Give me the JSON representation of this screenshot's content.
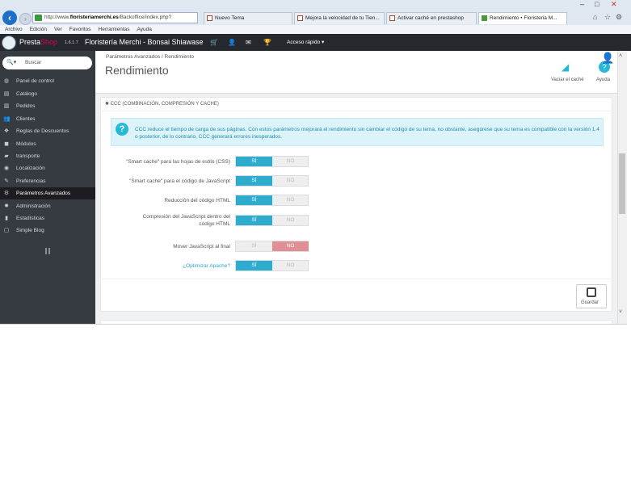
{
  "browser": {
    "url_prefix": "http://www.",
    "url_domain": "floristeriamerchi.es",
    "url_path": "/Backoffice/index.php?",
    "tabs": [
      "Nuevo Tema",
      "Mejora la velocidad de tu Tien...",
      "Activar caché en prestashop",
      "Rendimiento • Floristeria M..."
    ],
    "menu": [
      "Archivo",
      "Edición",
      "Ver",
      "Favoritos",
      "Herramientas",
      "Ayuda"
    ],
    "window_controls": [
      "–",
      "□",
      "✕"
    ]
  },
  "header": {
    "brand_presta": "Presta",
    "brand_shop": "Shop",
    "version": "1.6.1.7",
    "shop_name": "Floristería Merchi - Bonsai Shiawase",
    "quick_access": "Acceso rápido ▾"
  },
  "sidebar": {
    "search_placeholder": "Buscar",
    "items": [
      {
        "label": "Panel de control",
        "icon": "dashboard-icon",
        "glyph": "◍"
      },
      {
        "label": "Catálogo",
        "icon": "catalog-icon",
        "glyph": "▤"
      },
      {
        "label": "Pedidos",
        "icon": "orders-icon",
        "glyph": "▥"
      },
      {
        "label": "Clientes",
        "icon": "customers-icon",
        "glyph": "👥"
      },
      {
        "label": "Reglas de Descuentos",
        "icon": "discount-icon",
        "glyph": "❖"
      },
      {
        "label": "Módulos",
        "icon": "modules-icon",
        "glyph": "◼"
      },
      {
        "label": "transporte",
        "icon": "transport-icon",
        "glyph": "▰"
      },
      {
        "label": "Localización",
        "icon": "localization-icon",
        "glyph": "◉"
      },
      {
        "label": "Preferencias",
        "icon": "preferences-icon",
        "glyph": "✎"
      },
      {
        "label": "Parámetros Avanzados",
        "icon": "advanced-params-icon",
        "glyph": "⚙"
      },
      {
        "label": "Administración",
        "icon": "administration-icon",
        "glyph": "✹"
      },
      {
        "label": "Estadísticas",
        "icon": "stats-icon",
        "glyph": "▮"
      },
      {
        "label": "Simple Blog",
        "icon": "blog-icon",
        "glyph": "▢"
      }
    ],
    "active_index": 9
  },
  "page": {
    "breadcrumb": "Parámetros Avanzados  /  Rendimiento",
    "title": "Rendimiento",
    "clear_cache": "Vaciar el caché",
    "help": "Ayuda"
  },
  "panel": {
    "heading": "CCC (COMBINACIÓN, COMPRESIÓN Y CACHE)",
    "info": "CCC reduce el tiempo de carga de sus páginas. Con estos parámetros mejorará el rendimiento sin cambiar el código de su tema, no obstante, asegúrese que su tema es compatible con la versión 1.4 o posterior, de lo contrario, CCC generará errores inesperados.",
    "rows": [
      {
        "label": "\"Smart cache\" para las hojas de estilo (CSS)",
        "yes": "SÍ",
        "no": "NO",
        "value": "yes"
      },
      {
        "label": "\"Smart cache\" para el código de JavaScript",
        "yes": "SÍ",
        "no": "NO",
        "value": "yes"
      },
      {
        "label": "Reducción del código HTML",
        "yes": "SÍ",
        "no": "NO",
        "value": "yes"
      },
      {
        "label": "Compresión del JavaScript dentro del",
        "label2": "código HTML",
        "yes": "SÍ",
        "no": "NO",
        "value": "yes"
      },
      {
        "label": "Mover JavaScript al final",
        "yes": "SÍ",
        "no": "NO",
        "value": "no"
      },
      {
        "label": "¿Optimizar Apache?",
        "yes": "SÍ",
        "no": "NO",
        "value": "yes",
        "link": true
      }
    ],
    "save": "Guardar"
  }
}
